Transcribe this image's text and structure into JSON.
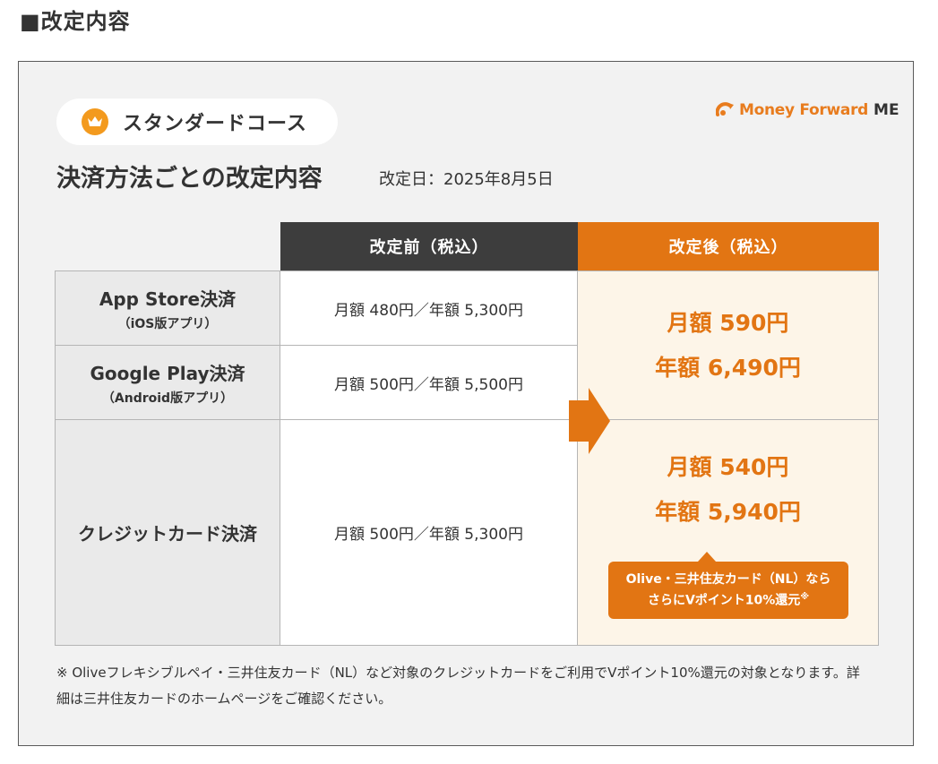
{
  "section_heading": "■改定内容",
  "course": {
    "icon": "crown-icon",
    "name": "スタンダードコース"
  },
  "logo": {
    "brand_text": "Money Forward",
    "suffix": "ME",
    "icon": "money-forward-logo-icon",
    "color": "#e87c1e"
  },
  "title": "決済方法ごとの改定内容",
  "revision_date": "改定日：2025年8月5日",
  "table": {
    "header_before": "改定前（税込）",
    "header_after": "改定後（税込）",
    "rows": [
      {
        "label": "App Store決済",
        "sub": "（iOS版アプリ）",
        "before": "月額 480円／年額 5,300円"
      },
      {
        "label": "Google Play決済",
        "sub": "（Android版アプリ）",
        "before": "月額 500円／年額 5,500円"
      },
      {
        "label": "クレジットカード決済",
        "before": "月額 500円／年額 5,300円"
      }
    ],
    "after_groups": [
      {
        "monthly": "月額 590円",
        "yearly": "年額 6,490円"
      },
      {
        "monthly": "月額 540円",
        "yearly": "年額 5,940円"
      }
    ]
  },
  "callout": {
    "line1": "Olive・三井住友カード（NL）なら",
    "line2": "さらにVポイント10%還元",
    "mark": "※"
  },
  "footnote": "※ Oliveフレキシブルペイ・三井住友カード（NL）など対象のクレジットカードをご利用でVポイント10%還元の対象となります。詳細は三井住友カードのホームページをご確認ください。",
  "colors": {
    "accent": "#e27513",
    "header_dark": "#3d3d3d",
    "highlight_bg": "#fdf5e8",
    "label_bg": "#eaeaea"
  }
}
